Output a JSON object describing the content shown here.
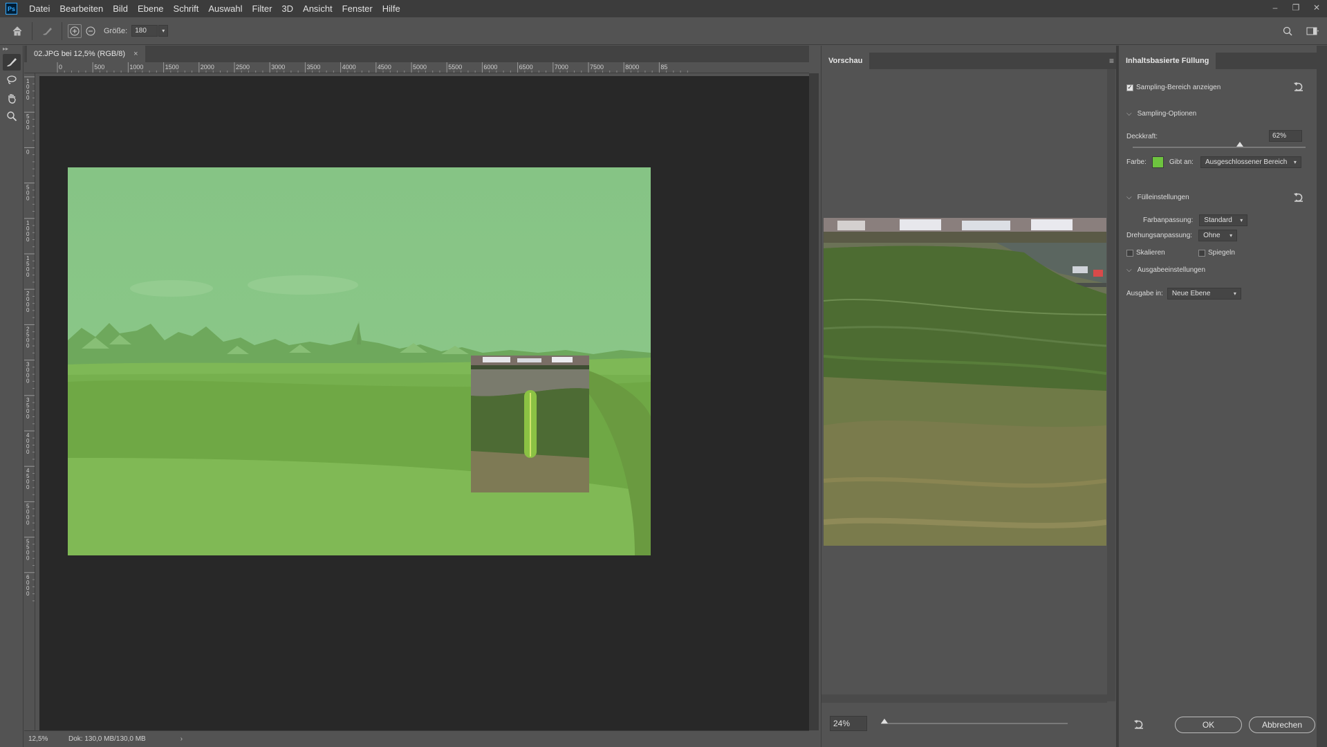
{
  "app": {
    "logo": "Ps",
    "menu": [
      "Datei",
      "Bearbeiten",
      "Bild",
      "Ebene",
      "Schrift",
      "Auswahl",
      "Filter",
      "3D",
      "Ansicht",
      "Fenster",
      "Hilfe"
    ]
  },
  "window_controls": {
    "minimize": "–",
    "restore": "❐",
    "close": "✕"
  },
  "options": {
    "size_label": "Größe:",
    "size_value": "180"
  },
  "document": {
    "tab_title": "02.JPG bei 12,5% (RGB/8)",
    "close": "×",
    "ruler_h_ticks": [
      "0",
      "500",
      "1000",
      "1500",
      "2000",
      "2500",
      "3000",
      "3500",
      "4000",
      "4500",
      "5000",
      "5500",
      "6000",
      "6500",
      "7000",
      "7500",
      "8000",
      "85"
    ],
    "ruler_v_ticks": [
      "1000",
      "500",
      "0",
      "500",
      "1000",
      "1500",
      "2000",
      "2500",
      "3000",
      "3500",
      "4000",
      "4500",
      "5000",
      "5500",
      "6000"
    ],
    "status_zoom": "12,5%",
    "status_doc": "Dok: 130,0 MB/130,0 MB",
    "status_arrow": "›",
    "overlay_color": "#7dc36b"
  },
  "preview": {
    "tab": "Vorschau",
    "zoom_value": "24%",
    "zoom_level": 0.02
  },
  "settings": {
    "tab": "Inhaltsbasierte Füllung",
    "show_sampling_label": "Sampling-Bereich anzeigen",
    "show_sampling_checked": true,
    "sampling_section": "Sampling-Optionen",
    "opacity_label": "Deckkraft:",
    "opacity_value": "62%",
    "opacity_level": 0.62,
    "color_label": "Farbe:",
    "color_value": "#6ec43f",
    "indicates_label": "Gibt an:",
    "indicates_value": "Ausgeschlossener Bereich",
    "fill_section": "Fülleinstellungen",
    "color_adapt_label": "Farbanpassung:",
    "color_adapt_value": "Standard",
    "rotation_adapt_label": "Drehungsanpassung:",
    "rotation_adapt_value": "Ohne",
    "scale_label": "Skalieren",
    "mirror_label": "Spiegeln",
    "output_section": "Ausgabeeinstellungen",
    "output_label": "Ausgabe in:",
    "output_value": "Neue Ebene",
    "ok": "OK",
    "cancel": "Abbrechen"
  }
}
